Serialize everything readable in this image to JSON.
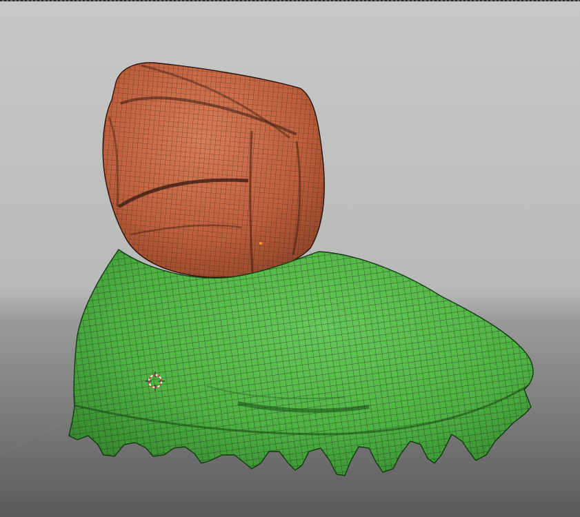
{
  "viewport": {
    "view": "3d-viewport",
    "background_color": "#c5c5c5",
    "floor_color": "#8a8a8a"
  },
  "mesh": {
    "name": "boot",
    "display": "wireframe-overlay",
    "wire_color": "#1b1b1b",
    "parts": [
      {
        "name": "upper-puffer",
        "color": "#c2613c"
      },
      {
        "name": "lower-shell",
        "color": "#4fb344"
      }
    ]
  },
  "icons": {
    "cursor": "3d-cursor-icon",
    "origin": "object-origin-icon"
  }
}
